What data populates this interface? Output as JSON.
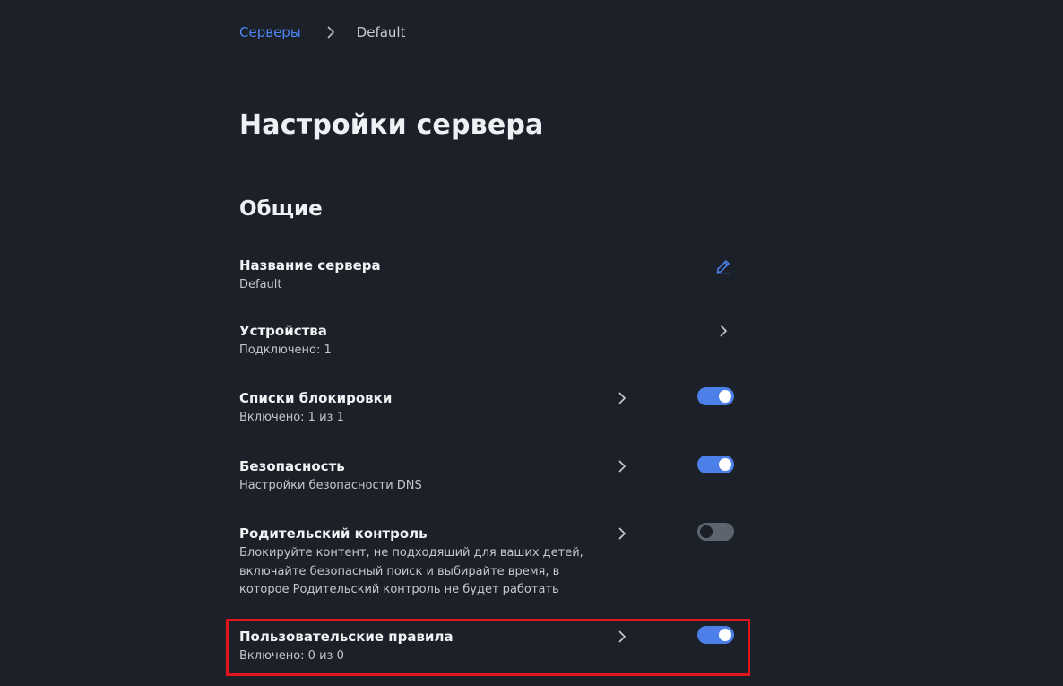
{
  "breadcrumb": {
    "parent": "Серверы",
    "current": "Default"
  },
  "page_title": "Настройки сервера",
  "section_title": "Общие",
  "settings": [
    {
      "title": "Название сервера",
      "subtitle": "Default",
      "action": "edit-icon"
    },
    {
      "title": "Устройства",
      "subtitle": "Подключено: 1",
      "action": "chevron-right-icon"
    },
    {
      "title": "Списки блокировки",
      "subtitle": "Включено: 1 из 1",
      "toggle": "on"
    },
    {
      "title": "Безопасность",
      "subtitle": "Настройки безопасности DNS",
      "toggle": "on"
    },
    {
      "title": "Родительский контроль",
      "subtitle_lines": [
        "Блокируйте контент, не подходящий для ваших детей,",
        "включайте безопасный поиск и выбирайте время, в",
        "которое Родительский контроль не будет работать"
      ],
      "toggle": "off"
    },
    {
      "title": "Пользовательские правила",
      "subtitle": "Включено: 0 из 0",
      "toggle": "on",
      "highlighted": true
    }
  ],
  "colors": {
    "background": "#1b2029",
    "accent": "#4d84f2",
    "toggle_on": "#4c7fe8",
    "toggle_off": "#5e646d",
    "highlight": "#e0161c"
  }
}
